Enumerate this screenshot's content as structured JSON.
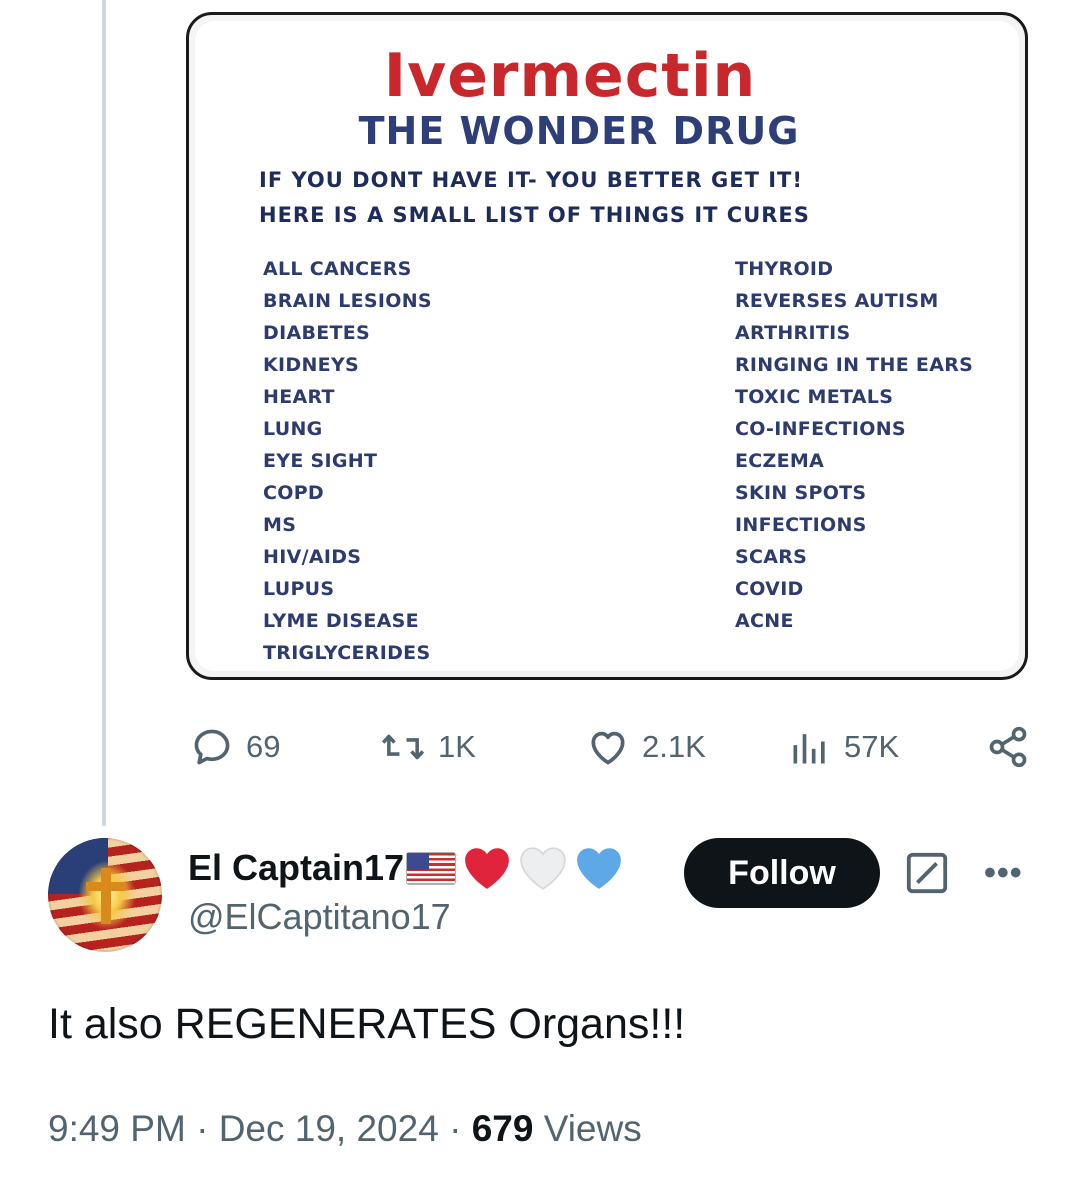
{
  "image_card": {
    "title": "Ivermectin",
    "subtitle": "THE WONDER DRUG",
    "line1": "IF YOU DONT HAVE IT- YOU BETTER GET IT!",
    "line2": "HERE IS A SMALL LIST OF THINGS IT CURES",
    "left_list": [
      "ALL CANCERS",
      "BRAIN LESIONS",
      "DIABETES",
      "KIDNEYS",
      "HEART",
      "LUNG",
      "EYE SIGHT",
      "COPD",
      "MS",
      "HIV/AIDS",
      "LUPUS",
      "LYME DISEASE",
      "TRIGLYCERIDES"
    ],
    "right_list": [
      "THYROID",
      "REVERSES AUTISM",
      "ARTHRITIS",
      "RINGING IN THE EARS",
      "TOXIC METALS",
      "CO-INFECTIONS",
      "ECZEMA",
      "SKIN SPOTS",
      "INFECTIONS",
      "SCARS",
      "COVID",
      "ACNE"
    ]
  },
  "actions": {
    "replies": "69",
    "reposts": "1K",
    "likes": "2.1K",
    "views": "57K",
    "icons": [
      "reply-icon",
      "retweet-icon",
      "like-icon",
      "views-icon",
      "share-icon"
    ]
  },
  "reply": {
    "display_name": "El Captain17",
    "name_emoji": [
      "us-flag-icon",
      "red-heart-icon",
      "white-heart-icon",
      "blue-heart-icon"
    ],
    "handle": "@ElCaptitano17",
    "follow_label": "Follow",
    "text": "It also REGENERATES Organs!!!",
    "time": "9:49 PM",
    "separator": "·",
    "date": "Dec 19, 2024",
    "views_count": "679",
    "views_label": "Views"
  },
  "colors": {
    "title_red": "#c8282c",
    "subtitle_navy": "#2e3e78",
    "text_primary": "#0f1419",
    "text_secondary": "#536471",
    "heart_red": "#e0243b",
    "heart_blue": "#5fa8e8",
    "thread_line": "#cfd9de"
  }
}
